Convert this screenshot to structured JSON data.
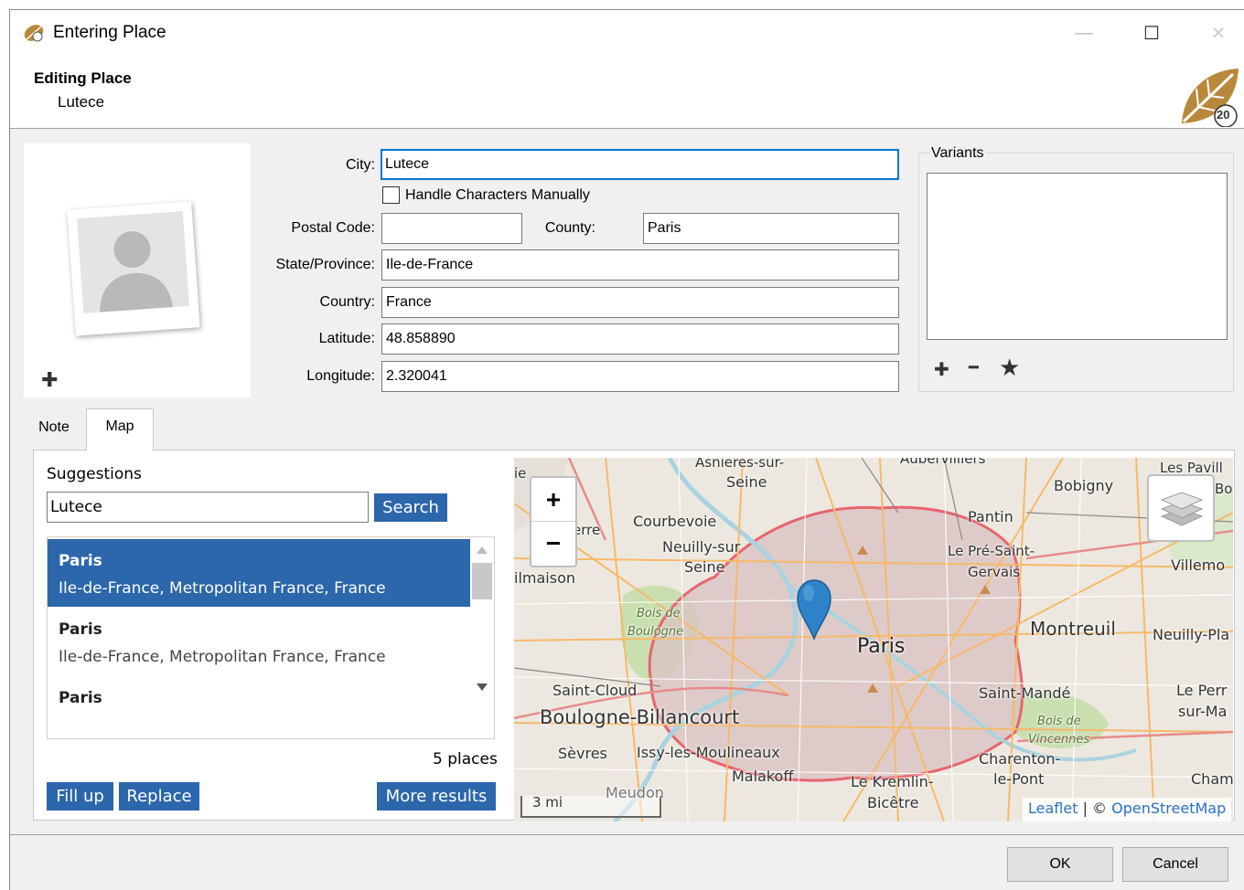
{
  "window": {
    "title": "Entering Place",
    "minimize": "—",
    "maximize": "☐",
    "close": "✕"
  },
  "header": {
    "title": "Editing Place",
    "subtitle": "Lutece",
    "badge": "20"
  },
  "form": {
    "city_label": "City:",
    "city_value": "Lutece",
    "handle_chars_label": "Handle Characters Manually",
    "postal_label": "Postal Code:",
    "postal_value": "",
    "county_label": "County:",
    "county_value": "Paris",
    "state_label": "State/Province:",
    "state_value": "Ile-de-France",
    "country_label": "Country:",
    "country_value": "France",
    "lat_label": "Latitude:",
    "lat_value": "48.858890",
    "lon_label": "Longitude:",
    "lon_value": "2.320041"
  },
  "variants": {
    "label": "Variants",
    "add": "✚",
    "remove": "━",
    "star": "★"
  },
  "photo": {
    "add": "✚"
  },
  "tabs": [
    {
      "label": "Note"
    },
    {
      "label": "Map"
    }
  ],
  "suggestions": {
    "label": "Suggestions",
    "query": "Lutece",
    "search_button": "Search",
    "items": [
      {
        "title": "Paris",
        "subtitle": "Ile-de-France, Metropolitan France, France"
      },
      {
        "title": "Paris",
        "subtitle": "Ile-de-France, Metropolitan France, France"
      },
      {
        "title": "Paris",
        "subtitle": ""
      }
    ],
    "count": "5 places",
    "fill_up": "Fill up",
    "replace": "Replace",
    "more_results": "More results"
  },
  "map": {
    "zoom_in": "+",
    "zoom_out": "−",
    "scale": "3 mi",
    "attribution_leaflet": "Leaflet",
    "attribution_sep": " | © ",
    "attribution_osm": "OpenStreetMap",
    "labels": {
      "asnieres": "Asnieres-sur-",
      "seine1": "Seine",
      "aubervilliers": "Aubervilliers",
      "lespavill": "Les Pavill",
      "bobigny": "Bobigny",
      "bo": "Bo",
      "pantin": "Pantin",
      "courbevoie": "Courbevoie",
      "erre": "erre",
      "neuilly": "Neuilly-sur",
      "seine2": "Seine",
      "lepre": "Le Pré-Saint-",
      "gervais": "Gervais",
      "villemo": "Villemo",
      "ilmaison": "ilmaison",
      "boisdeboulogne1": "Bois de",
      "boisdeboulogne2": "Boulogne",
      "paris": "Paris",
      "montreuil": "Montreuil",
      "neuillypla": "Neuilly-Pla",
      "saintcloud": "Saint-Cloud",
      "saintmande": "Saint-Mandé",
      "leperr": "Le Perr",
      "surma": "sur-Ma",
      "boulogne": "Boulogne-Billancourt",
      "boisvincennes1": "Bois de",
      "boisvincennes2": "Vincennes",
      "sevres": "Sèvres",
      "issy": "Issy-les-Moulineaux",
      "charenton": "Charenton-",
      "lepont": "le-Pont",
      "malakoff": "Malakoff",
      "kremlin": "Le Kremlin-",
      "bicetre": "Bicêtre",
      "champ": "Champ",
      "meudon": "Meudon",
      "ie": "ie"
    }
  },
  "footer": {
    "ok": "OK",
    "cancel": "Cancel"
  }
}
